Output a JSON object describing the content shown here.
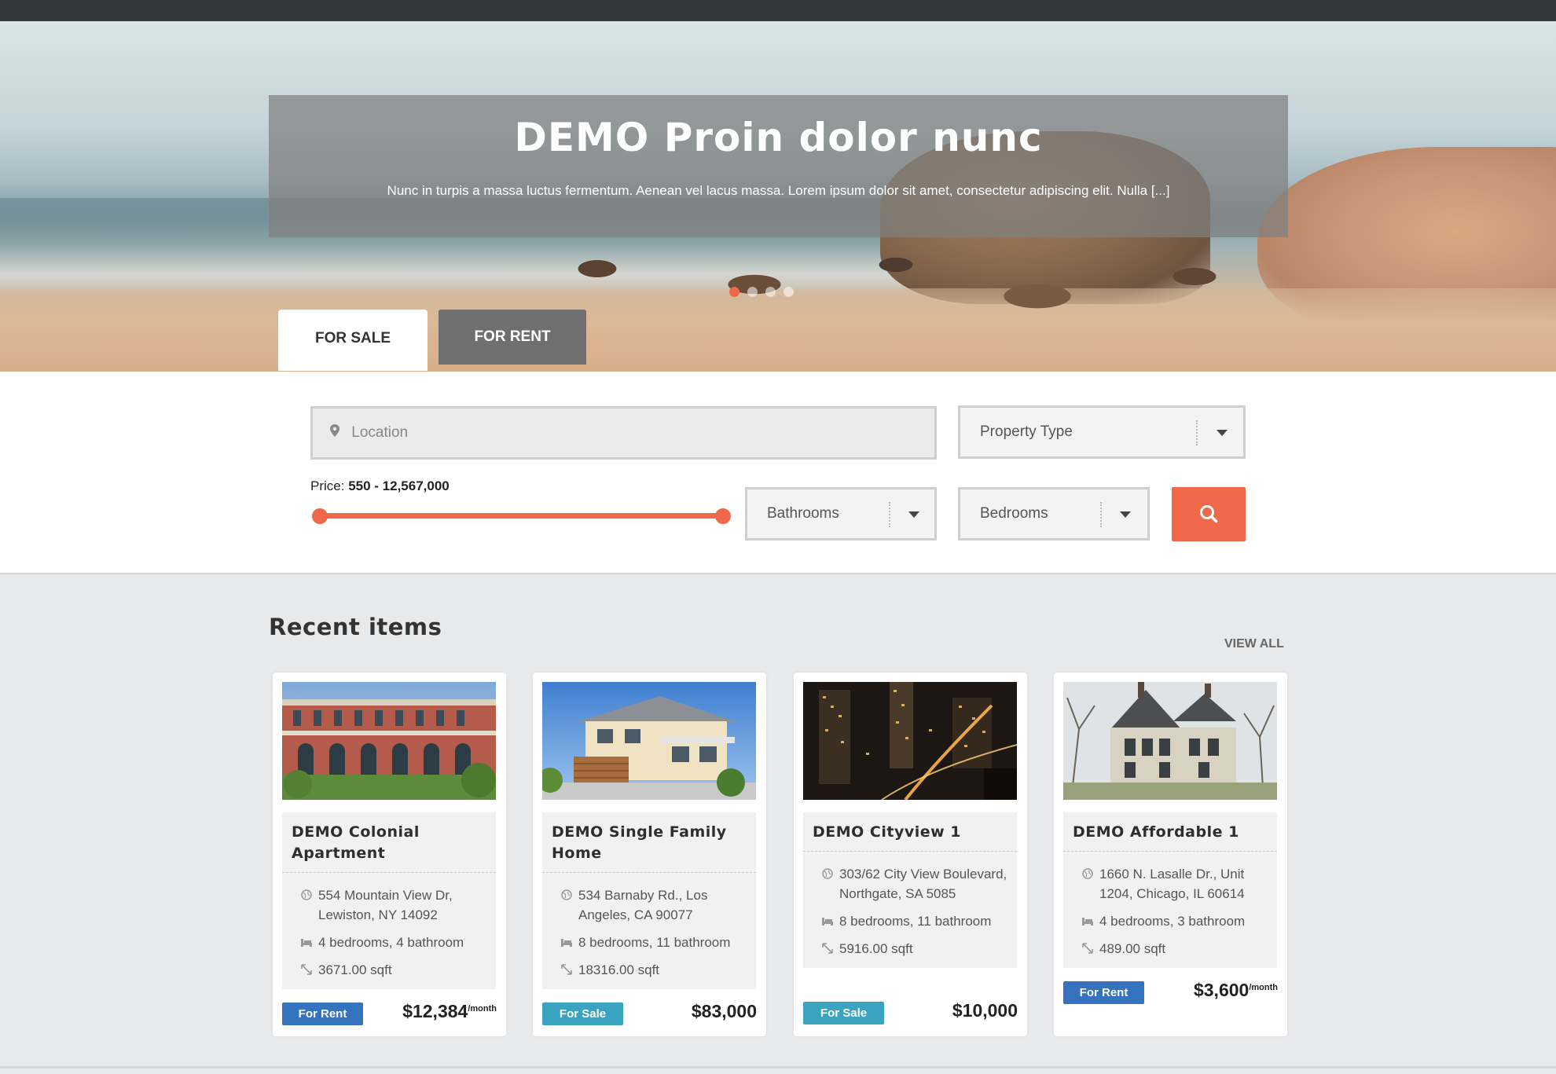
{
  "hero": {
    "title": "DEMO Proin dolor nunc",
    "description": "Nunc in turpis a massa luctus fermentum. Aenean vel lacus massa. Lorem ipsum dolor sit amet, consectetur adipiscing elit. Nulla [...]",
    "slides_count": 4,
    "active_slide": 1
  },
  "tabs": [
    {
      "label": "FOR SALE",
      "active": true
    },
    {
      "label": "FOR RENT",
      "active": false
    }
  ],
  "search": {
    "location_placeholder": "Location",
    "property_type": "Property Type",
    "bathrooms": "Bathrooms",
    "bedrooms": "Bedrooms",
    "price_label": "Price:",
    "price_range": "550 - 12,567,000"
  },
  "recent": {
    "title": "Recent items",
    "view_all": "VIEW ALL"
  },
  "listings": [
    {
      "title": "DEMO Colonial Apartment",
      "address": "554 Mountain View Dr, Lewiston, NY 14092",
      "rooms": "4 bedrooms, 4 bathroom",
      "area": "3671.00 sqft",
      "status": "For Rent",
      "price": "$12,384",
      "price_suffix": "/month"
    },
    {
      "title": "DEMO Single Family Home",
      "address": "534 Barnaby Rd., Los Angeles, CA 90077",
      "rooms": "8 bedrooms, 11 bathroom",
      "area": "18316.00 sqft",
      "status": "For Sale",
      "price": "$83,000",
      "price_suffix": ""
    },
    {
      "title": "DEMO Cityview 1",
      "address": "303/62 City View Boulevard, Northgate, SA 5085",
      "rooms": "8 bedrooms, 11 bathroom",
      "area": "5916.00 sqft",
      "status": "For Sale",
      "price": "$10,000",
      "price_suffix": ""
    },
    {
      "title": "DEMO Affordable 1",
      "address": "1660 N. Lasalle Dr., Unit 1204, Chicago, IL 60614",
      "rooms": "4 bedrooms, 3 bathroom",
      "area": "489.00 sqft",
      "status": "For Rent",
      "price": "$3,600",
      "price_suffix": "/month"
    }
  ],
  "colors": {
    "accent": "#f0684a",
    "rent_badge": "#3673bf",
    "sale_badge": "#3aa3c0",
    "topbar": "#33373b"
  }
}
